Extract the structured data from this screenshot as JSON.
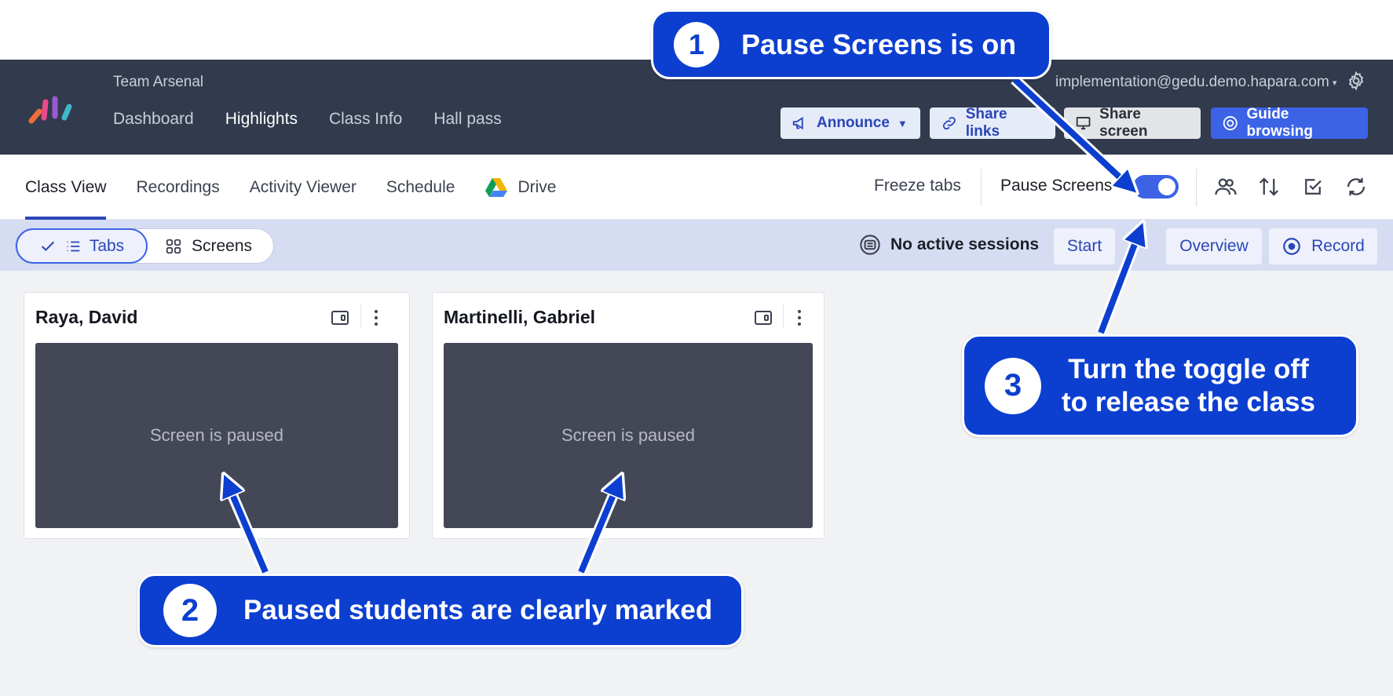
{
  "header": {
    "team": "Team Arsenal",
    "nav": [
      "Dashboard",
      "Highlights",
      "Class Info",
      "Hall pass"
    ],
    "active_nav": "Highlights",
    "email": "implementation@gedu.demo.hapara.com",
    "buttons": {
      "announce": "Announce",
      "share_links": "Share links",
      "share_screen": "Share screen",
      "guide_browsing": "Guide browsing"
    }
  },
  "subnav": {
    "tabs": [
      "Class View",
      "Recordings",
      "Activity Viewer",
      "Schedule",
      "Drive"
    ],
    "active_tab": "Class View",
    "freeze_tabs": "Freeze tabs",
    "pause_screens": "Pause Screens",
    "pause_screens_on": true,
    "icons": [
      "users-icon",
      "sort-icon",
      "select-icon",
      "refresh-icon"
    ]
  },
  "toolbar": {
    "view_tabs": "Tabs",
    "view_screens": "Screens",
    "sessions": "No active sessions",
    "start": "Start",
    "overview": "Overview",
    "record": "Record"
  },
  "students": [
    {
      "name": "Raya, David",
      "status": "Screen is paused"
    },
    {
      "name": "Martinelli, Gabriel",
      "status": "Screen is paused"
    }
  ],
  "callouts": [
    {
      "num": "1",
      "text": "Pause Screens is on"
    },
    {
      "num": "2",
      "text": "Paused students are clearly marked"
    },
    {
      "num": "3",
      "line1": "Turn the toggle off",
      "line2": "to release the class"
    }
  ],
  "colors": {
    "header_bg": "#323a4d",
    "accent": "#3c63e6",
    "callout": "#0c3fd0",
    "paused_screen": "#434756"
  }
}
